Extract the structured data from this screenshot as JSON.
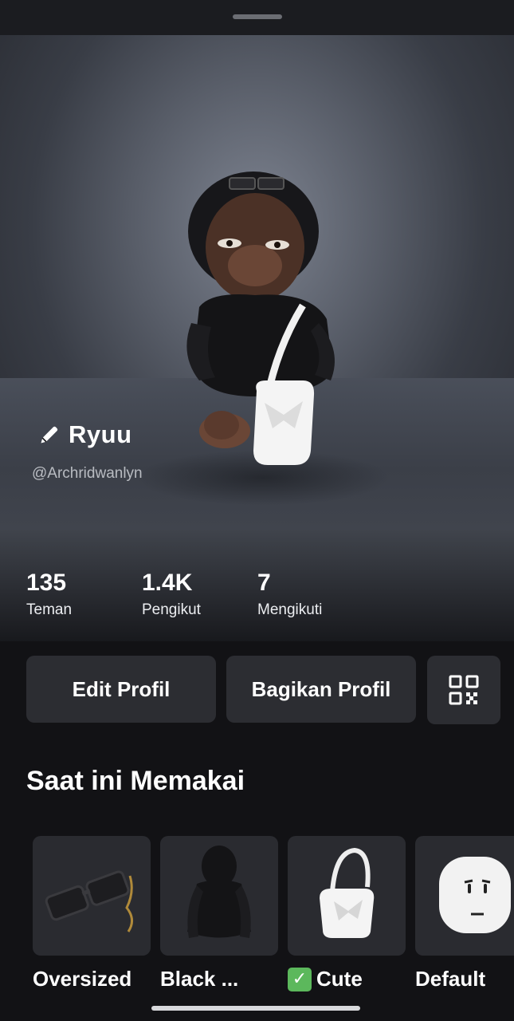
{
  "profile": {
    "display_name": "Ryuu",
    "username": "@Archridwanlyn"
  },
  "stats": [
    {
      "value": "135",
      "label": "Teman"
    },
    {
      "value": "1.4K",
      "label": "Pengikut"
    },
    {
      "value": "7",
      "label": "Mengikuti"
    }
  ],
  "actions": {
    "edit_label": "Edit Profil",
    "share_label": "Bagikan Profil",
    "qr_icon": "qr-code-icon"
  },
  "wearing": {
    "title": "Saat ini Memakai",
    "items": [
      {
        "label": "Oversized",
        "icon": "sunglasses-icon",
        "checked": false
      },
      {
        "label": "Black ...",
        "icon": "hoodie-icon",
        "checked": false
      },
      {
        "label": "Cute",
        "icon": "bag-icon",
        "checked": true
      },
      {
        "label": "Default",
        "icon": "face-icon",
        "checked": false
      }
    ]
  },
  "colors": {
    "background": "#121215",
    "button": "#2c2d32",
    "check": "#5cb85c"
  }
}
